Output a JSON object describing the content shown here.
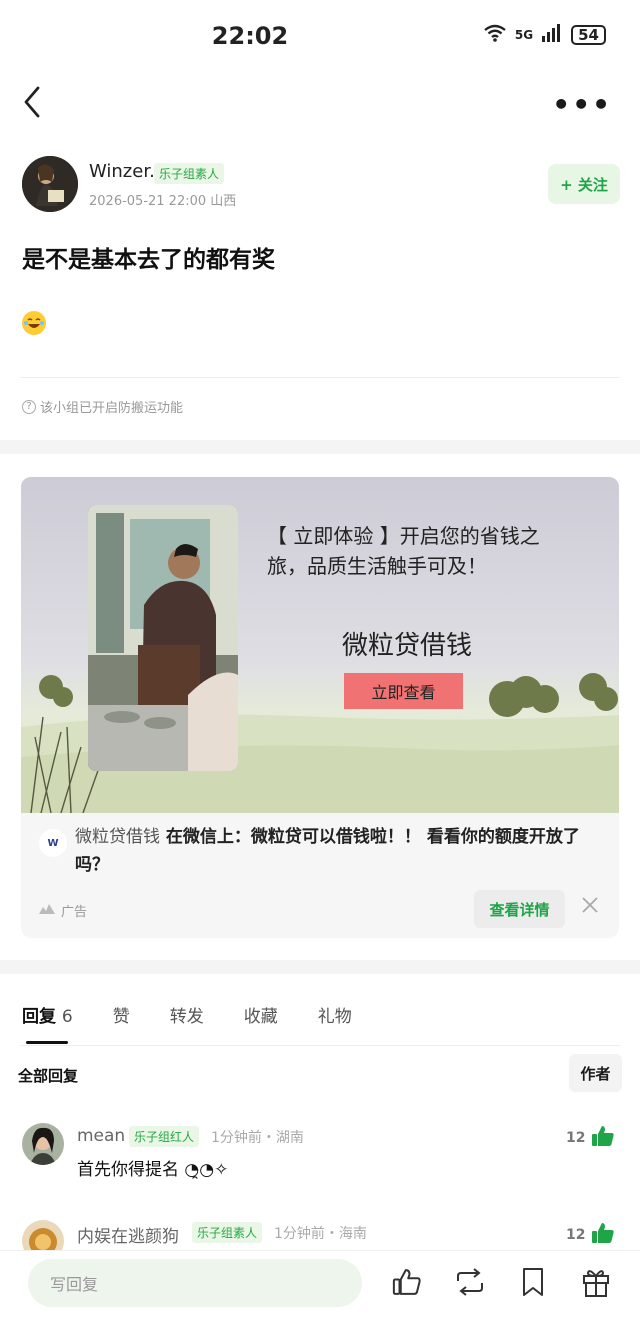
{
  "status_bar": {
    "time": "22:02",
    "wifi_label": "6",
    "network": "5G",
    "battery": "54"
  },
  "nav": {
    "more_label": "•••"
  },
  "post": {
    "username": "Winzer.",
    "badge": "乐子组素人",
    "meta": "2026-05-21 22:00  山西",
    "follow_label": "+ 关注",
    "text": "是不是基本去了的都有奖",
    "notice": "该小组已开启防搬运功能"
  },
  "ad": {
    "headline": "【 立即体验 】开启您的省钱之旅，品质生活触手可及！",
    "brand": "微粒贷借钱",
    "cta": "立即查看",
    "logo_text": "W",
    "advertiser": "微粒贷借钱",
    "description": "在微信上：微粒贷可以借钱啦！！ 看看你的额度开放了吗？",
    "label": "广告",
    "detail_button": "查看详情"
  },
  "tabs": [
    {
      "label": "回复",
      "count": "6",
      "active": true
    },
    {
      "label": "赞"
    },
    {
      "label": "转发"
    },
    {
      "label": "收藏"
    },
    {
      "label": "礼物"
    }
  ],
  "replies_header": {
    "title": "全部回复",
    "author_toggle": "作者"
  },
  "comments": [
    {
      "name": "mean",
      "badge": "乐子组红人",
      "meta": "1分钟前・湖南",
      "text": "首先你得提名 ◔̯◔✧",
      "likes": "12"
    },
    {
      "name": "内娱在逃颜狗",
      "badge": "乐子组素人",
      "meta": "1分钟前・海南",
      "likes": "12"
    }
  ],
  "bottom_bar": {
    "reply_placeholder": "写回复"
  },
  "colors": {
    "accent_green": "#1fa548",
    "cta_red": "#f07272",
    "badge_bg": "#eaf7e6"
  }
}
